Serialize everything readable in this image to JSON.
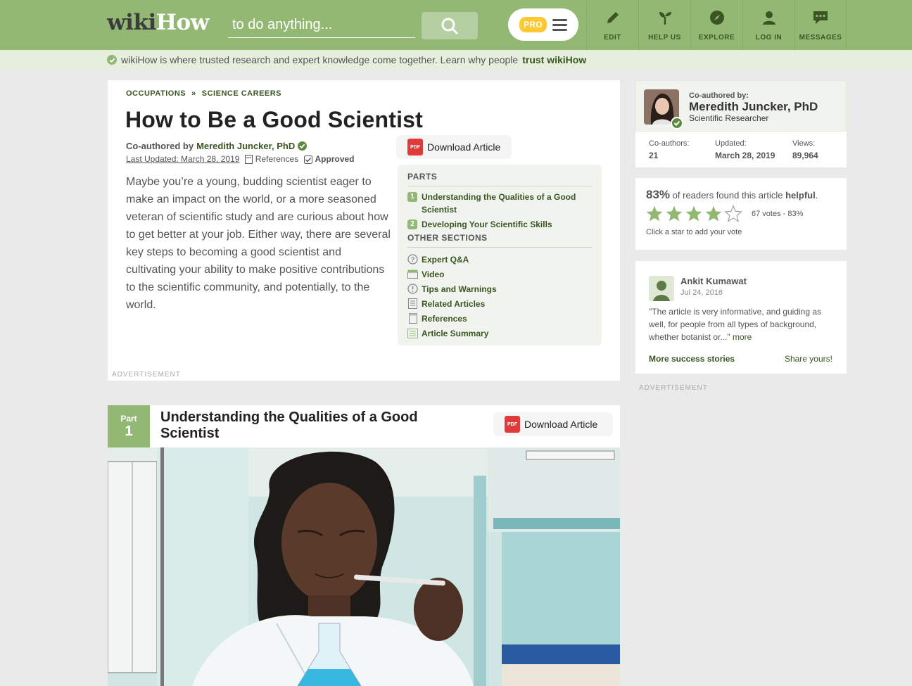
{
  "header": {
    "logo_wiki": "wiki",
    "logo_how": "How",
    "search_placeholder": "to do anything...",
    "pro_badge": "PRO",
    "nav": [
      {
        "label": "EDIT",
        "icon": "pencil-icon"
      },
      {
        "label": "HELP US",
        "icon": "sprout-icon"
      },
      {
        "label": "EXPLORE",
        "icon": "compass-icon"
      },
      {
        "label": "LOG IN",
        "icon": "user-icon"
      },
      {
        "label": "MESSAGES",
        "icon": "chat-bubble-icon"
      }
    ]
  },
  "trust_bar": {
    "text": "wikiHow is where trusted research and expert knowledge come together. Learn why people",
    "link": "trust wikiHow"
  },
  "article": {
    "breadcrumbs": [
      "OCCUPATIONS",
      "SCIENCE CAREERS"
    ],
    "breadcrumb_sep": "»",
    "title": "How to Be a Good Scientist",
    "coauthored_prefix": "Co-authored by",
    "author": "Meredith Juncker, PhD",
    "last_updated": "Last Updated: March 28, 2019",
    "references": "References",
    "approved": "Approved",
    "intro": "Maybe you’re a young, budding scientist eager to make an impact on the world, or a more seasoned veteran of scientific study and are curious about how to get better at your job. Either way, there are several key steps to becoming a good scientist and cultivating your ability to make positive contributions to the scientific community, and potentially, to the world.",
    "download_label": "Download Article",
    "advertisement": "ADVERTISEMENT"
  },
  "toc": {
    "parts_heading": "PARTS",
    "parts": [
      {
        "num": "1",
        "label": "Understanding the Qualities of a Good Scientist"
      },
      {
        "num": "2",
        "label": "Developing Your Scientific Skills"
      }
    ],
    "other_heading": "OTHER SECTIONS",
    "sections": [
      {
        "label": "Expert Q&A",
        "icon": "question-icon"
      },
      {
        "label": "Video",
        "icon": "video-clapper-icon"
      },
      {
        "label": "Tips and Warnings",
        "icon": "exclamation-icon"
      },
      {
        "label": "Related Articles",
        "icon": "document-icon"
      },
      {
        "label": "References",
        "icon": "page-icon"
      },
      {
        "label": "Article Summary",
        "icon": "summary-icon"
      }
    ]
  },
  "part1": {
    "part_label": "Part",
    "part_num": "1",
    "title": "Understanding the Qualities of a Good Scientist",
    "download_label": "Download Article"
  },
  "author_card": {
    "coauthored_label": "Co-authored by:",
    "name": "Meredith Juncker, PhD",
    "role": "Scientific Researcher",
    "stats": [
      {
        "label": "Co-authors:",
        "value": "21"
      },
      {
        "label": "Updated:",
        "value": "March 28, 2019"
      },
      {
        "label": "Views:",
        "value": "89,964"
      }
    ]
  },
  "helpful": {
    "percent": "83%",
    "text_pre": "of readers found this article",
    "text_bold": "helpful",
    "votes": "67 votes - 83%",
    "click_hint": "Click a star to add your vote",
    "rating": 4,
    "max_rating": 5
  },
  "review": {
    "name": "Ankit Kumawat",
    "date": "Jul 24, 2016",
    "text": "\"The article is very informative, and guiding as well, for people from all types of background, whether botanist or...\"",
    "more": "more",
    "more_stories": "More success stories",
    "share": "Share yours!"
  },
  "sidebar_ad": "ADVERTISEMENT",
  "colors": {
    "brand_green": "#93b874",
    "dark_green": "#3a5522",
    "pro_yellow": "#fec832",
    "pdf_red": "#e03b3b"
  }
}
